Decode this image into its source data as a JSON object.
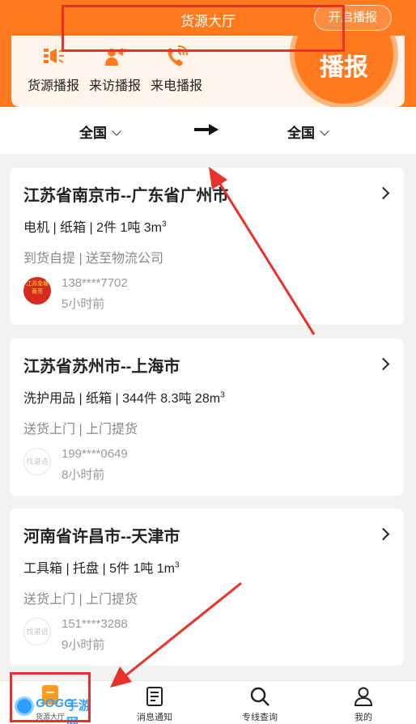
{
  "header": {
    "title": "货源大厅",
    "open_button": "开启播报"
  },
  "features": [
    {
      "label": "货源播报",
      "icon": "cargo-broadcast-icon"
    },
    {
      "label": "来访播报",
      "icon": "visitor-broadcast-icon"
    },
    {
      "label": "来电播报",
      "icon": "call-broadcast-icon"
    }
  ],
  "broadcast_button": "播报",
  "route": {
    "from": "全国",
    "to": "全国"
  },
  "listings": [
    {
      "route": "江苏省南京市--广东省广州市",
      "goods": "电机 | 纸箱 | 2件 1吨 3m",
      "unit_power": "3",
      "service": "到货自提 | 送至物流公司",
      "phone": "138****7702",
      "time": "5小时前",
      "avatar_text": "江苏金塘 黄亮"
    },
    {
      "route": "江苏省苏州市--上海市",
      "goods": "洗护用品 | 纸箱 | 344件 8.3吨 28m",
      "unit_power": "3",
      "service": "送货上门 | 上门提货",
      "phone": "199****0649",
      "time": "8小时前",
      "avatar_text": "找谌语"
    },
    {
      "route": "河南省许昌市--天津市",
      "goods": "工具箱 | 托盘 | 5件 1吨 1m",
      "unit_power": "3",
      "service": "送货上门 | 上门提货",
      "phone": "151****3288",
      "time": "9小时前",
      "avatar_text": "找谌语"
    }
  ],
  "tabs": [
    {
      "label": "货源大厅"
    },
    {
      "label": "消息通知"
    },
    {
      "label": "专线查询"
    },
    {
      "label": "我的"
    }
  ],
  "watermark": {
    "brand": "GOGO",
    "name": "手游网",
    "sub": "货源大厅"
  },
  "colors": {
    "brand": "#ff7a1e",
    "annotation": "#e8312a",
    "watermark": "#2ea0ff"
  }
}
